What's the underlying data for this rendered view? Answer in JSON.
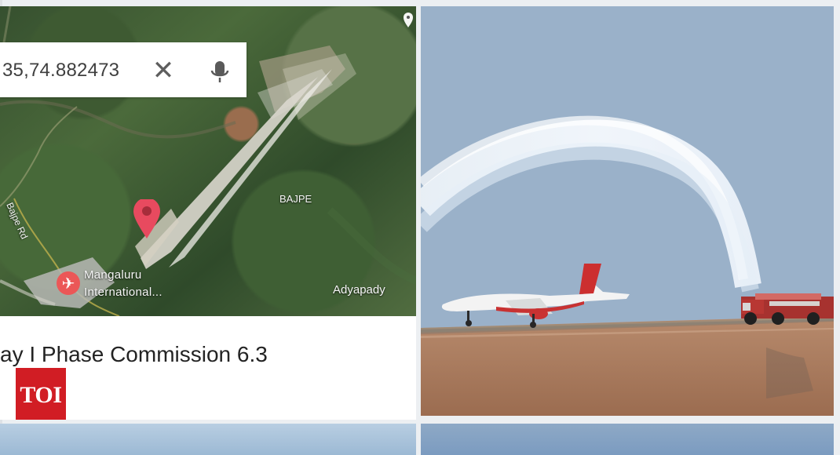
{
  "map": {
    "search_text": "35,74.882473",
    "close_icon": "close-icon",
    "mic_icon": "microphone-icon",
    "labels": {
      "bajpe": "BAJPE",
      "bajpe_road": "Bajpe Rd",
      "airport_line1": "Mangaluru",
      "airport_line2": "International...",
      "adyapady": "Adyapady"
    }
  },
  "caption": {
    "text": "ay I Phase Commission 6.3",
    "badge": "TOI"
  },
  "colors": {
    "pin": "#e84a5f",
    "badge": "#d11d24"
  }
}
